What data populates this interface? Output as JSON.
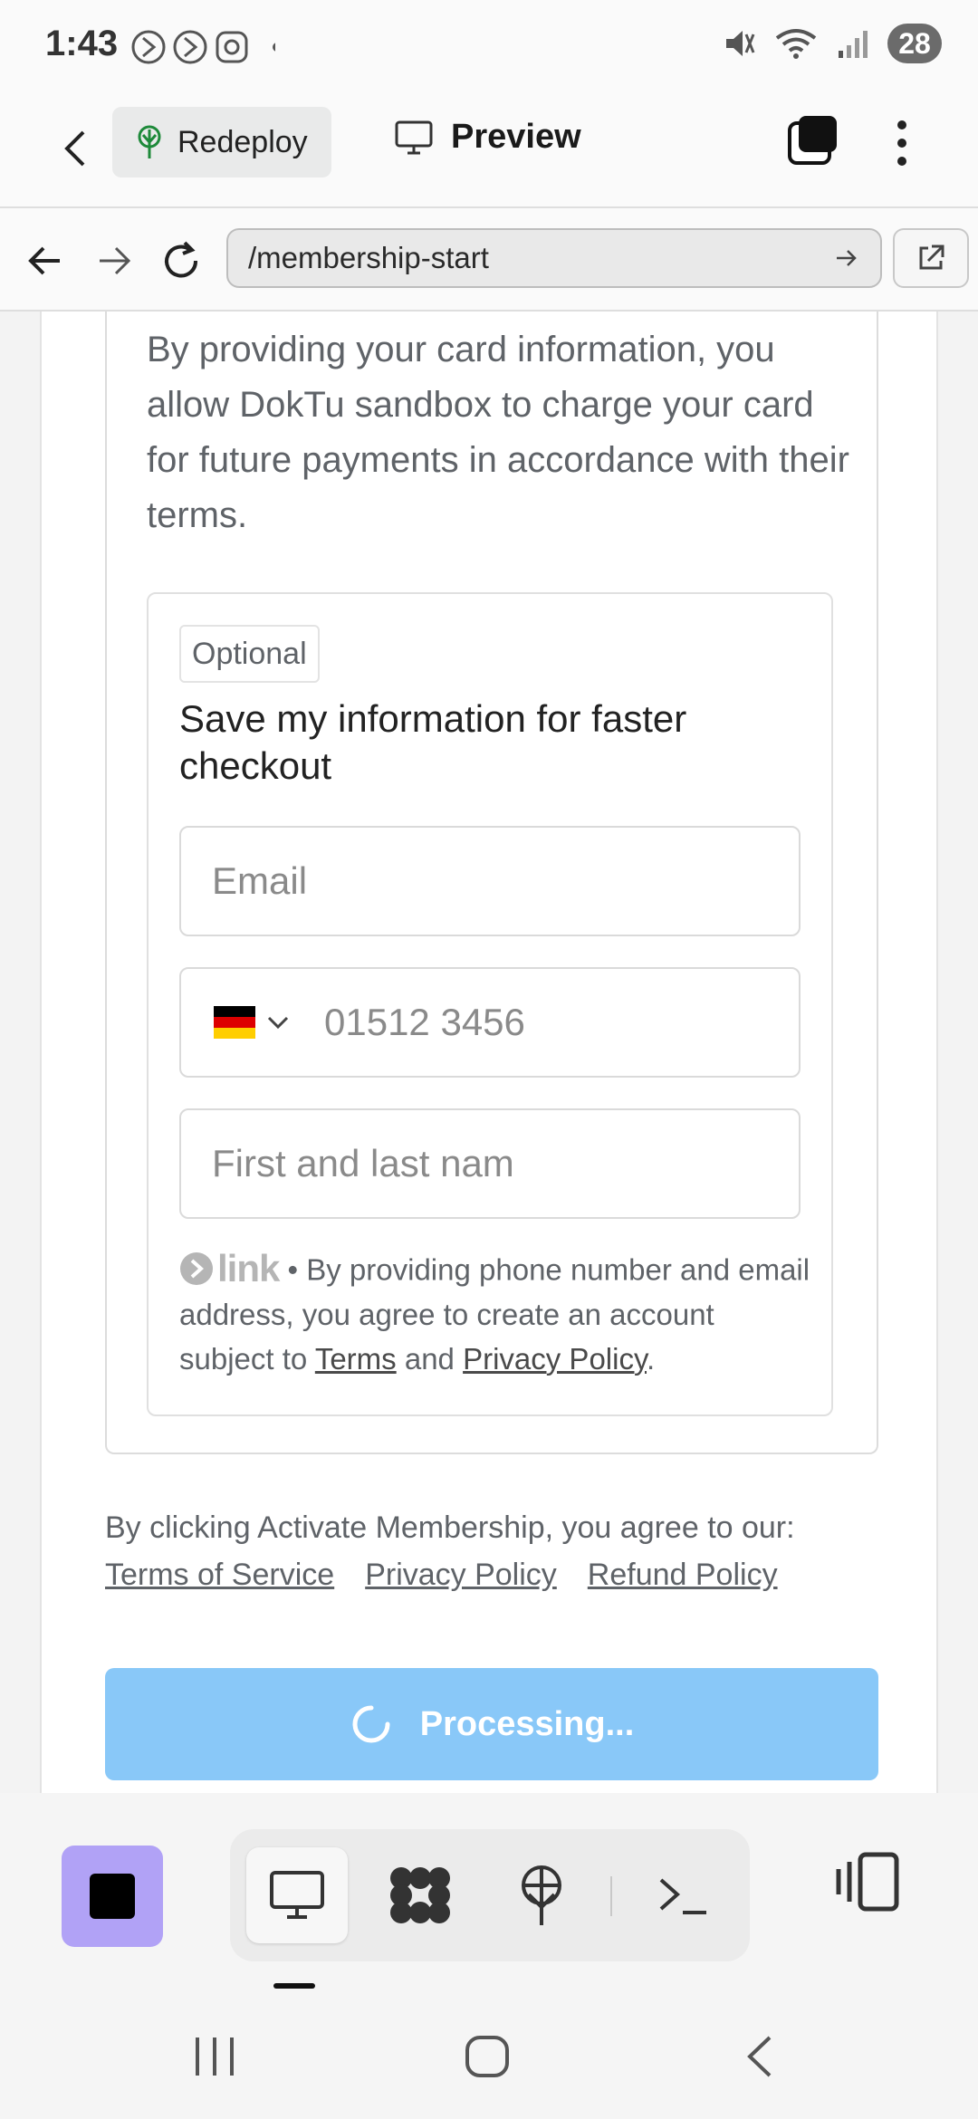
{
  "status_bar": {
    "time": "1:43",
    "battery": "28"
  },
  "header": {
    "redeploy_label": "Redeploy",
    "preview_label": "Preview"
  },
  "browser": {
    "url": "/membership-start"
  },
  "consent_text": "By providing your card information, you allow DokTu sandbox to charge your card for future payments in accordance with their terms.",
  "link_box": {
    "optional_badge": "Optional",
    "title": "Save my information for faster checkout",
    "email_placeholder": "Email",
    "phone_placeholder": "01512 3456",
    "name_placeholder": "First and last nam",
    "link_brand": "link",
    "legal_prefix": " • By providing phone number and email address, you agree to create an account subject to ",
    "terms": "Terms",
    "and": " and ",
    "privacy": "Privacy Policy",
    "period": "."
  },
  "agreement": {
    "text": "By clicking Activate Membership, you agree to our:",
    "links": [
      "Terms of Service",
      "Privacy Policy",
      "Refund Policy"
    ]
  },
  "submit": {
    "label": "Processing...",
    "color": "#89c8f8"
  },
  "colors": {
    "stop_button": "#b1a2f6",
    "flag": [
      "#000000",
      "#dd0000",
      "#ffce00"
    ]
  }
}
